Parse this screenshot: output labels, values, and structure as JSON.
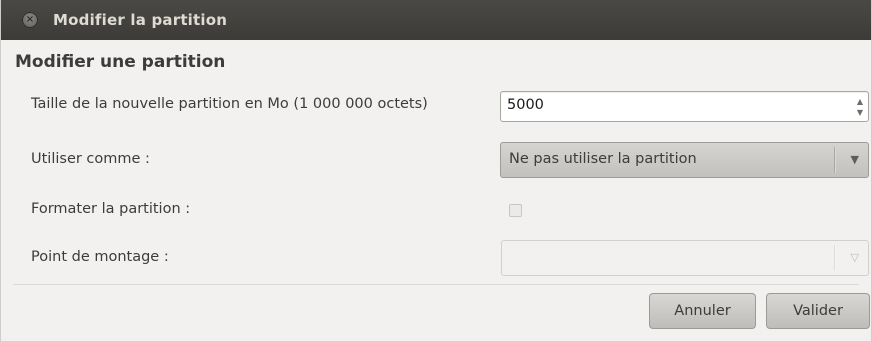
{
  "window": {
    "title": "Modifier la partition",
    "close_glyph": "×"
  },
  "dialog": {
    "heading": "Modifier une partition",
    "size": {
      "label": "Taille de la nouvelle partition en Mo (1 000 000 octets)",
      "value": "5000"
    },
    "use_as": {
      "label": "Utiliser comme :",
      "selected": "Ne pas utiliser la partition"
    },
    "format": {
      "label": "Formater la partition :",
      "checked": false
    },
    "mount_point": {
      "label": "Point de montage :",
      "selected": ""
    }
  },
  "buttons": {
    "cancel_label": "Annuler",
    "ok_label": "Valider"
  },
  "icons": {
    "spin_up": "▲",
    "spin_down": "▼",
    "combo_arrow": "▼",
    "combo_arrow_disabled": "▽"
  },
  "colors": {
    "titlebar": "#3c3b37",
    "window_bg": "#f2f1f0",
    "text": "#3c3c3c"
  }
}
